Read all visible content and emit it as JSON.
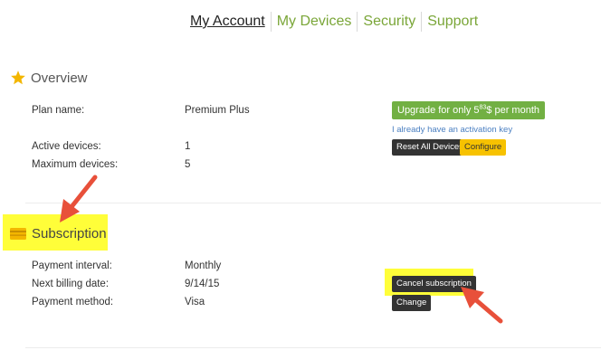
{
  "nav": {
    "items": [
      {
        "label": "My Account",
        "active": true
      },
      {
        "label": "My Devices",
        "active": false
      },
      {
        "label": "Security",
        "active": false
      },
      {
        "label": "Support",
        "active": false
      }
    ]
  },
  "overview": {
    "title": "Overview",
    "icon": "star-icon",
    "plan_label": "Plan name:",
    "plan_value": "Premium Plus",
    "active_label": "Active devices:",
    "active_value": "1",
    "max_label": "Maximum devices:",
    "max_value": "5",
    "upgrade_prefix": "Upgrade for only 5",
    "upgrade_cents": "83",
    "upgrade_suffix": "$ per month",
    "activation_link": "I already have an activation key",
    "reset_button": "Reset All Devices",
    "configure_button": "Configure"
  },
  "subscription": {
    "title": "Subscription",
    "icon": "credit-card-icon",
    "interval_label": "Payment interval:",
    "interval_value": "Monthly",
    "billing_label": "Next billing date:",
    "billing_value": "9/14/15",
    "method_label": "Payment method:",
    "method_value": "Visa",
    "cancel_button": "Cancel subscription",
    "change_button": "Change"
  },
  "colors": {
    "accent_green": "#72b043",
    "nav_link": "#7aa638",
    "highlight": "#fffe39",
    "annotation_arrow": "#e8503a",
    "star": "#f3b600",
    "configure": "#f7c200"
  }
}
